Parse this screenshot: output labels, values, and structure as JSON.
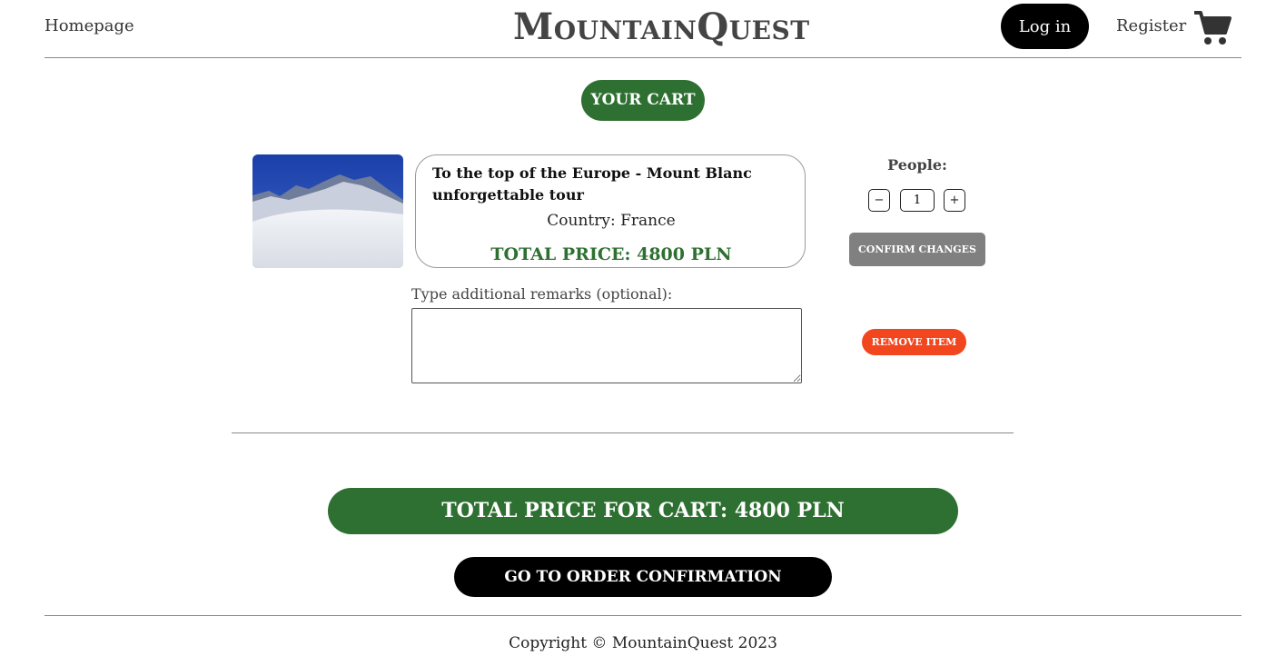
{
  "header": {
    "home_label": "Homepage",
    "brand": "MountainQuest",
    "login_label": "Log in",
    "register_label": "Register",
    "cart_icon": "shopping-cart-icon"
  },
  "cart": {
    "heading": "YOUR CART",
    "item": {
      "title": "To the top of the Europe - Mount Blanc unforgettable tour",
      "country": "Country: France",
      "price": "TOTAL PRICE: 4800 PLN",
      "image_icon": "mountain-photo"
    },
    "people_label": "People:",
    "minus_label": "−",
    "plus_label": "+",
    "quantity": "1",
    "confirm_label": "CONFIRM CHANGES",
    "remarks_label": "Type additional remarks (optional):",
    "remarks_value": "",
    "remove_label": "REMOVE ITEM",
    "total_label": "TOTAL PRICE FOR CART: 4800 PLN",
    "order_label": "GO TO ORDER CONFIRMATION"
  },
  "footer": {
    "copyright": "Copyright © MountainQuest 2023"
  },
  "colors": {
    "accent_green": "#2e7031",
    "remove_red": "#f2461f",
    "confirm_gray": "#808080",
    "primary_black": "#000000"
  }
}
